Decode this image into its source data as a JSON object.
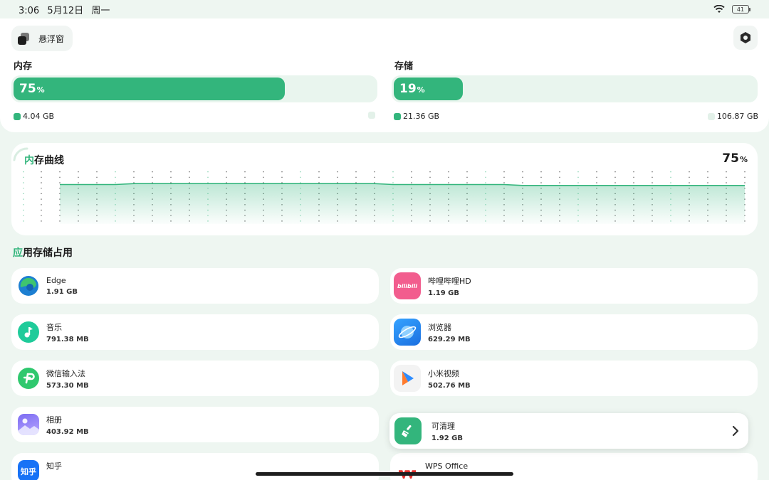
{
  "status_bar": {
    "time": "3:06",
    "date": "5月12日",
    "weekday": "周一",
    "battery": "41"
  },
  "header": {
    "floating_window_label": "悬浮窗"
  },
  "memory": {
    "title": "内存",
    "percent": "75",
    "percent_sign": "%",
    "fraction": 0.75,
    "used": "4.04 GB"
  },
  "storage": {
    "title": "存储",
    "percent": "19",
    "percent_sign": "%",
    "fraction": 0.19,
    "used": "21.36 GB",
    "total": "106.87 GB"
  },
  "memory_curve": {
    "title_accent": "内",
    "title_rest": "存曲线",
    "current_percent": "75",
    "percent_sign": "%",
    "series": [
      75,
      75,
      75,
      75,
      76,
      76,
      76,
      76,
      76,
      76,
      76,
      76,
      76,
      76,
      76,
      76,
      76,
      76,
      75,
      75,
      75,
      75,
      75,
      75,
      75,
      74,
      74,
      74,
      74,
      74,
      74,
      74,
      74,
      74,
      74,
      74,
      74,
      74
    ]
  },
  "app_storage": {
    "title_accent": "应",
    "title_rest": "用存储占用",
    "left": [
      {
        "name": "Edge",
        "size": "1.91 GB",
        "icon": "edge-icon"
      },
      {
        "name": "音乐",
        "size": "791.38 MB",
        "icon": "music-icon"
      },
      {
        "name": "微信输入法",
        "size": "573.30 MB",
        "icon": "wechat-input-icon"
      },
      {
        "name": "相册",
        "size": "403.92 MB",
        "icon": "gallery-icon"
      },
      {
        "name": "知乎",
        "size": "",
        "icon": "zhihu-icon",
        "icon_text": "知乎"
      }
    ],
    "right": [
      {
        "name": "哔哩哔哩HD",
        "size": "1.19 GB",
        "icon": "bilibili-icon",
        "icon_text": "bilibili"
      },
      {
        "name": "浏览器",
        "size": "629.29 MB",
        "icon": "browser-icon"
      },
      {
        "name": "小米视频",
        "size": "502.76 MB",
        "icon": "mi-video-icon"
      },
      {
        "name": "WPS Office",
        "size": "",
        "icon": "wps-icon"
      }
    ]
  },
  "cleanable": {
    "label": "可清理",
    "size": "1.92 GB"
  },
  "colors": {
    "accent": "#33b57c",
    "track": "#e9f5ee",
    "background": "#eef6f1"
  }
}
